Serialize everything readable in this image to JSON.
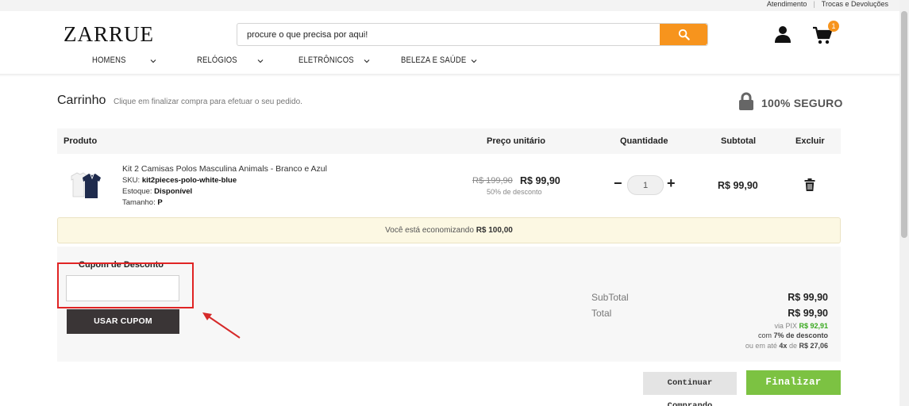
{
  "topbar": {
    "link1": "Atendimento",
    "link2": "Trocas e Devoluções"
  },
  "header": {
    "logo": "ZARRUE",
    "search_value": "procure o que precisa por aqui!",
    "cart_count": "1",
    "icons": {
      "search": "search-icon",
      "user": "user-icon",
      "cart": "cart-icon"
    }
  },
  "nav": {
    "items": [
      {
        "label": "HOMENS"
      },
      {
        "label": "RELÓGIOS"
      },
      {
        "label": "ELETRÔNICOS"
      },
      {
        "label": "BELEZA E SAÚDE"
      }
    ]
  },
  "cart": {
    "title": "Carrinho",
    "subtitle": "Clique em finalizar compra para efetuar o seu pedido.",
    "secure_label": "100% SEGURO",
    "headers": {
      "product": "Produto",
      "unit_price": "Preço unitário",
      "quantity": "Quantidade",
      "subtotal": "Subtotal",
      "remove": "Excluir"
    },
    "item": {
      "name": "Kit 2 Camisas Polos Masculina Animals - Branco e Azul",
      "sku_label": "SKU:",
      "sku": "kit2pieces-polo-white-blue",
      "stock_label": "Estoque:",
      "stock": "Disponível",
      "size_label": "Tamanho:",
      "size": "P",
      "price_old": "R$ 199,90",
      "price_new": "R$ 99,90",
      "discount": "50% de desconto",
      "qty_minus": "−",
      "qty": "1",
      "qty_plus": "+",
      "subtotal": "R$ 99,90"
    },
    "savings_text": "Você está economizando",
    "savings_value": "R$ 100,00",
    "coupon": {
      "label": "Cupom de Desconto",
      "value": "",
      "button": "USAR CUPOM"
    },
    "summary": {
      "subtotal_label": "SubTotal",
      "subtotal": "R$ 99,90",
      "total_label": "Total",
      "total": "R$ 99,90",
      "pix_prefix": "via PIX",
      "pix_value": "R$ 92,91",
      "pix_discount_prefix": "com",
      "pix_discount": "7% de desconto",
      "installments_prefix": "ou em até",
      "installments_count": "4x",
      "installments_mid": "de",
      "installments_value": "R$ 27,06"
    },
    "buttons": {
      "continue": "Continuar Comprando",
      "finish": "Finalizar Compra"
    }
  },
  "colors": {
    "accent": "#f7941d",
    "finish": "#7cc242",
    "pix": "#39a81f",
    "highlight": "#e02424"
  }
}
